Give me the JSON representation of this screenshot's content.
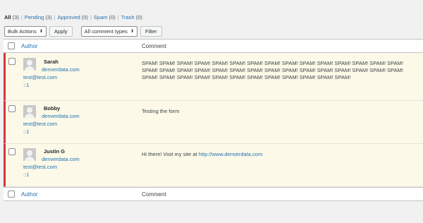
{
  "filters": {
    "all": {
      "label": "All",
      "count": "(3)"
    },
    "pending": {
      "label": "Pending",
      "count": "(3)"
    },
    "approved": {
      "label": "Approved",
      "count": "(0)"
    },
    "spam": {
      "label": "Spam",
      "count": "(0)"
    },
    "trash": {
      "label": "Trash",
      "count": "(0)"
    },
    "separator": "|"
  },
  "tablenav": {
    "bulk_actions": "Bulk Actions",
    "apply": "Apply",
    "comment_types": "All comment types",
    "filter": "Filter"
  },
  "columns": {
    "author": "Author",
    "comment": "Comment"
  },
  "comments": [
    {
      "name": "Sarah",
      "site": "denverdata.com",
      "email": "test@test.com",
      "ip": "::1",
      "text_lines": [
        "SPAM! SPAM! SPAM! SPAM! SPAM! SPAM! SPAM! SPAM! SPAM! SPAM! SPAM! SPAM! SPAM! SPAM! SPAM!",
        "SPAM! SPAM! SPAM! SPAM! SPAM! SPAM! SPAM! SPAM! SPAM! SPAM! SPAM! SPAM! SPAM! SPAM! SPAM!",
        "SPAM! SPAM! SPAM! SPAM! SPAM! SPAM! SPAM! SPAM! SPAM! SPAM! SPAM! SPAM!"
      ]
    },
    {
      "name": "Bobby",
      "site": "denverdata.com",
      "email": "test@test.com",
      "ip": "::1",
      "text": "Testing the form"
    },
    {
      "name": "Justin G",
      "site": "denverdata.com",
      "email": "test@test.com",
      "ip": "::1",
      "text_prefix": "Hi there! Visit my site at ",
      "text_link": "http://www.denverdata.com"
    }
  ]
}
